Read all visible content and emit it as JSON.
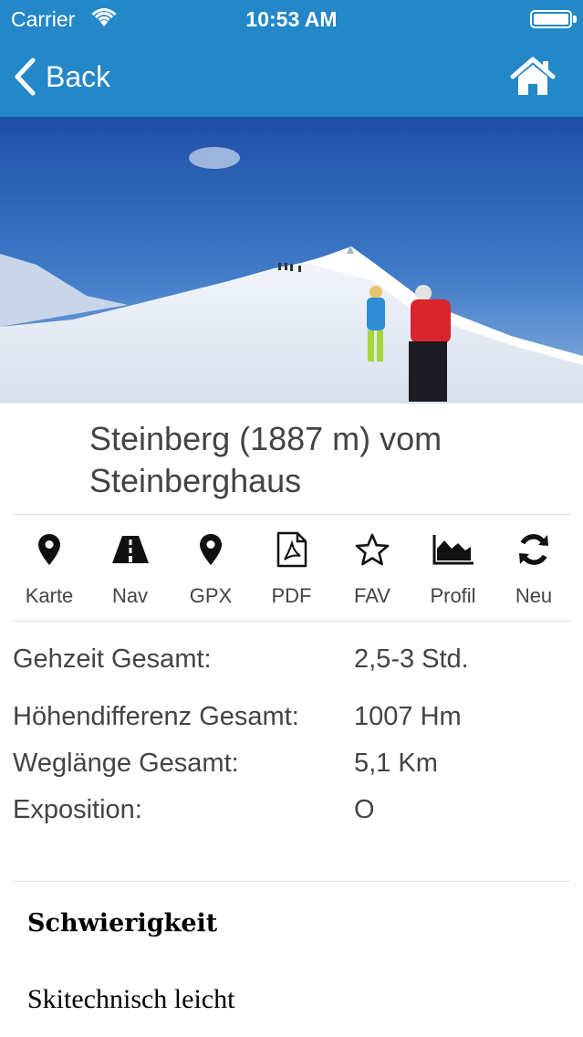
{
  "status_bar": {
    "carrier": "Carrier",
    "time": "10:53 AM"
  },
  "nav": {
    "back_label": "Back",
    "home_icon": "home-icon"
  },
  "hero_image": {
    "subject": "ski-tour-photo"
  },
  "tour": {
    "title": "Steinberg (1887 m) vom Steinberghaus"
  },
  "toolbar": [
    {
      "label": "Karte",
      "icon": "map-pin-icon"
    },
    {
      "label": "Nav",
      "icon": "road-icon"
    },
    {
      "label": "GPX",
      "icon": "map-pin-icon"
    },
    {
      "label": "PDF",
      "icon": "pdf-icon"
    },
    {
      "label": "FAV",
      "icon": "star-icon"
    },
    {
      "label": "Profil",
      "icon": "area-chart-icon"
    },
    {
      "label": "Neu",
      "icon": "refresh-icon"
    }
  ],
  "details": [
    {
      "label": "Gehzeit Gesamt:",
      "value": "2,5-3 Std."
    },
    {
      "label": "Höhendifferenz Gesamt:",
      "value": "1007 Hm"
    },
    {
      "label": "Weglänge Gesamt:",
      "value": "5,1 Km"
    },
    {
      "label": "Exposition:",
      "value": "O"
    }
  ],
  "difficulty": {
    "heading": "Schwierigkeit",
    "value": "Skitechnisch leicht"
  },
  "colors": {
    "header": "#2387c8",
    "text": "#444444"
  }
}
